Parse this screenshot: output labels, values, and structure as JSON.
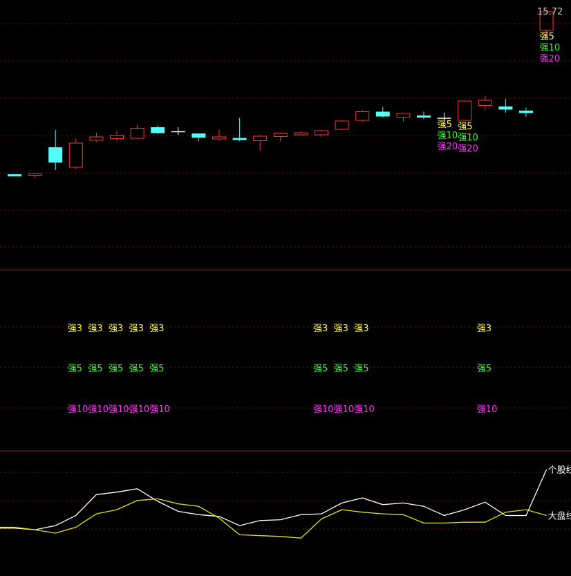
{
  "colors": {
    "up": "#ff3333",
    "down": "#54fcfc",
    "doji": "#ffffff",
    "grid": "#7a1010",
    "divider": "#9a1818",
    "yellow": "#ffff33",
    "green": "#33ff33",
    "magenta": "#ff33ff",
    "stock_line": "#ffffff",
    "market_line": "#e6e600",
    "price_label": "#c8c8c8"
  },
  "chart_data": [
    {
      "type": "candlestick",
      "title": "",
      "price_label": "15.72",
      "ylim": [
        9.7,
        15.9
      ],
      "candles": [
        {
          "o": 11.02,
          "h": 11.02,
          "l": 11.0,
          "c": 11.0
        },
        {
          "o": 10.99,
          "h": 11.03,
          "l": 10.92,
          "c": 11.03
        },
        {
          "o": 11.8,
          "h": 12.3,
          "l": 11.14,
          "c": 11.36
        },
        {
          "o": 11.22,
          "h": 12.05,
          "l": 11.17,
          "c": 11.92
        },
        {
          "o": 12.0,
          "h": 12.22,
          "l": 11.95,
          "c": 12.1
        },
        {
          "o": 12.05,
          "h": 12.27,
          "l": 11.97,
          "c": 12.15
        },
        {
          "o": 12.06,
          "h": 12.45,
          "l": 12.03,
          "c": 12.35
        },
        {
          "o": 12.38,
          "h": 12.43,
          "l": 12.19,
          "c": 12.21
        },
        {
          "o": 12.25,
          "h": 12.38,
          "l": 12.16,
          "c": 12.24
        },
        {
          "o": 12.2,
          "h": 12.2,
          "l": 11.98,
          "c": 12.08
        },
        {
          "o": 12.04,
          "h": 12.3,
          "l": 11.99,
          "c": 12.1
        },
        {
          "o": 12.07,
          "h": 12.65,
          "l": 11.98,
          "c": 12.01
        },
        {
          "o": 11.99,
          "h": 12.16,
          "l": 11.7,
          "c": 12.12
        },
        {
          "o": 12.11,
          "h": 12.23,
          "l": 11.97,
          "c": 12.21
        },
        {
          "o": 12.16,
          "h": 12.27,
          "l": 12.13,
          "c": 12.22
        },
        {
          "o": 12.16,
          "h": 12.31,
          "l": 12.09,
          "c": 12.28
        },
        {
          "o": 12.32,
          "h": 12.54,
          "l": 12.3,
          "c": 12.56
        },
        {
          "o": 12.58,
          "h": 12.88,
          "l": 12.53,
          "c": 12.83
        },
        {
          "o": 12.83,
          "h": 12.97,
          "l": 12.66,
          "c": 12.69
        },
        {
          "o": 12.67,
          "h": 12.8,
          "l": 12.54,
          "c": 12.78
        },
        {
          "o": 12.72,
          "h": 12.83,
          "l": 12.61,
          "c": 12.66
        },
        {
          "o": 12.64,
          "h": 12.8,
          "l": 12.58,
          "c": 12.64
        },
        {
          "o": 12.58,
          "h": 13.14,
          "l": 12.57,
          "c": 13.14
        },
        {
          "o": 13.01,
          "h": 13.28,
          "l": 12.87,
          "c": 13.16
        },
        {
          "o": 12.98,
          "h": 13.2,
          "l": 12.8,
          "c": 12.89
        },
        {
          "o": 12.86,
          "h": 12.95,
          "l": 12.68,
          "c": 12.79
        },
        {
          "o": 15.18,
          "h": 15.76,
          "l": 14.98,
          "c": 15.72
        }
      ],
      "strength_labels": [
        {
          "index": 21,
          "items": [
            {
              "text": "强5",
              "color": "yellow"
            },
            {
              "text": "强10",
              "color": "green"
            },
            {
              "text": "强20",
              "color": "magenta"
            }
          ]
        },
        {
          "index": 22,
          "items": [
            {
              "text": "强5",
              "color": "yellow"
            },
            {
              "text": "强10",
              "color": "green"
            },
            {
              "text": "强20",
              "color": "magenta"
            }
          ]
        },
        {
          "index": 26,
          "items": [
            {
              "text": "强5",
              "color": "yellow"
            },
            {
              "text": "强10",
              "color": "green"
            },
            {
              "text": "强20",
              "color": "magenta"
            }
          ]
        }
      ]
    },
    {
      "type": "signal-rows",
      "indices": [
        3,
        4,
        5,
        6,
        7,
        15,
        16,
        17,
        23
      ],
      "rows": [
        {
          "text": "强3",
          "color": "yellow"
        },
        {
          "text": "强5",
          "color": "green"
        },
        {
          "text": "强10",
          "color": "magenta"
        }
      ]
    },
    {
      "type": "line",
      "ylim": [
        0,
        100
      ],
      "series": [
        {
          "name": "个股线",
          "color": "stock_line",
          "values": [
            30,
            28,
            33,
            45,
            70,
            73,
            77,
            62,
            50,
            46,
            44,
            33,
            39,
            40,
            46,
            47,
            60,
            66,
            58,
            60,
            56,
            45,
            52,
            61,
            45,
            45,
            100
          ]
        },
        {
          "name": "大盘线",
          "color": "market_line",
          "values": [
            31,
            28,
            24,
            31,
            47,
            52,
            63,
            65,
            59,
            56,
            42,
            22,
            21,
            20,
            18,
            41,
            52,
            49,
            47,
            46,
            36,
            36,
            37,
            37,
            49,
            52,
            45
          ]
        }
      ]
    }
  ]
}
